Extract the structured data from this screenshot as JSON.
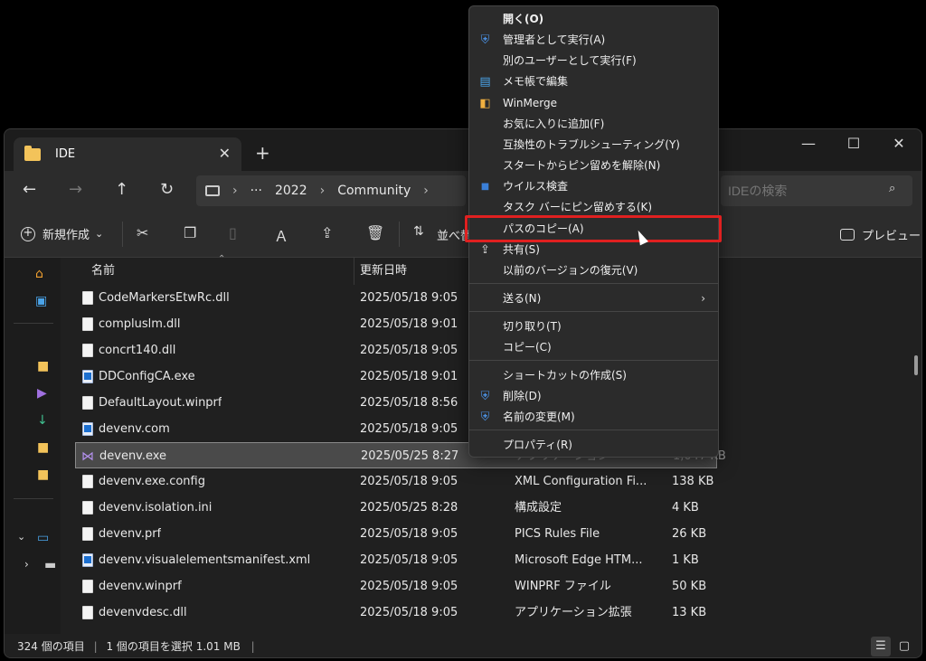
{
  "titlebar": {
    "tab_label": "IDE",
    "tab_close": "✕",
    "new_tab": "+",
    "minimize": "—",
    "maximize": "☐",
    "close": "✕"
  },
  "address": {
    "back": "←",
    "forward": "→",
    "up": "↑",
    "refresh": "↻",
    "more": "···",
    "crumbs": [
      "2022",
      "Community"
    ],
    "sep": "›",
    "search_placeholder": "IDEの検索"
  },
  "toolbar": {
    "new_label": "新規作成",
    "new_caret": "⌄",
    "sort_label": "並べ替",
    "preview_label": "プレビュー"
  },
  "columns": {
    "name": "名前",
    "modified": "更新日時"
  },
  "files": [
    {
      "name": "CodeMarkersEtwRc.dll",
      "date": "2025/05/18 9:05",
      "type": "",
      "size": ""
    },
    {
      "name": "compluslm.dll",
      "date": "2025/05/18 9:01",
      "type": "",
      "size": ""
    },
    {
      "name": "concrt140.dll",
      "date": "2025/05/18 9:05",
      "type": "",
      "size": ""
    },
    {
      "name": "DDConfigCA.exe",
      "date": "2025/05/18 9:01",
      "type": "",
      "size": ""
    },
    {
      "name": "DefaultLayout.winprf",
      "date": "2025/05/18 8:56",
      "type": "",
      "size": ""
    },
    {
      "name": "devenv.com",
      "date": "2025/05/18 9:05",
      "type": "",
      "size": ""
    },
    {
      "name": "devenv.exe",
      "date": "2025/05/25 8:27",
      "type": "アプリケーション",
      "size": "1,047 KB"
    },
    {
      "name": "devenv.exe.config",
      "date": "2025/05/18 9:05",
      "type": "XML Configuration Fi...",
      "size": "138 KB"
    },
    {
      "name": "devenv.isolation.ini",
      "date": "2025/05/25 8:28",
      "type": "構成設定",
      "size": "4 KB"
    },
    {
      "name": "devenv.prf",
      "date": "2025/05/18 9:05",
      "type": "PICS Rules File",
      "size": "26 KB"
    },
    {
      "name": "devenv.visualelementsmanifest.xml",
      "date": "2025/05/18 9:05",
      "type": "Microsoft Edge HTM...",
      "size": "1 KB"
    },
    {
      "name": "devenv.winprf",
      "date": "2025/05/18 9:05",
      "type": "WINPRF ファイル",
      "size": "50 KB"
    },
    {
      "name": "devenvdesc.dll",
      "date": "2025/05/18 9:05",
      "type": "アプリケーション拡張",
      "size": "13 KB"
    }
  ],
  "status": {
    "count": "324 個の項目",
    "selected": "1 個の項目を選択  1.01 MB"
  },
  "menu": {
    "items": [
      "開く(O)",
      "管理者として実行(A)",
      "別のユーザーとして実行(F)",
      "メモ帳で編集",
      "WinMerge",
      "お気に入りに追加(F)",
      "互換性のトラブルシューティング(Y)",
      "スタートからピン留めを解除(N)",
      "ウイルス検査",
      "タスク バーにピン留めする(K)",
      "パスのコピー(A)",
      "共有(S)",
      "以前のバージョンの復元(V)",
      "送る(N)",
      "切り取り(T)",
      "コピー(C)",
      "ショートカットの作成(S)",
      "削除(D)",
      "名前の変更(M)",
      "プロパティ(R)"
    ],
    "submenu_arrow": "›"
  },
  "colors": {
    "highlight_border": "#e02020",
    "folder": "#f3c35a",
    "accent": "#1b6fd1"
  }
}
